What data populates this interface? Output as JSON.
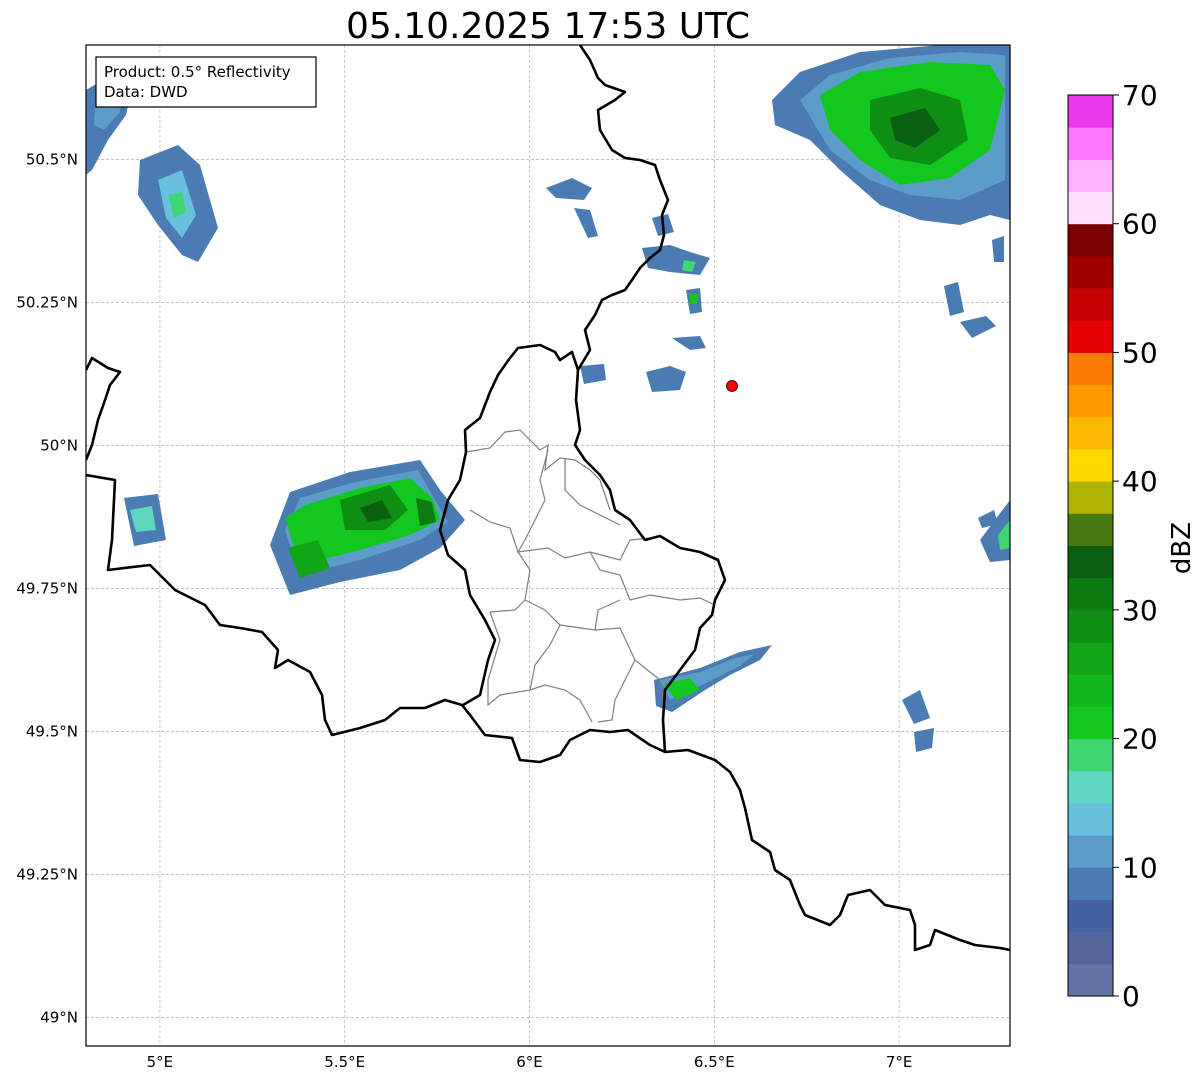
{
  "title": "05.10.2025 17:53 UTC",
  "info_box": {
    "product": "Product: 0.5° Reflectivity",
    "data": "Data: DWD"
  },
  "map": {
    "lon_ticks": [
      "5°E",
      "5.5°E",
      "6°E",
      "6.5°E",
      "7°E"
    ],
    "lat_ticks": [
      "50.5°N",
      "50.25°N",
      "50°N",
      "49.75°N",
      "49.5°N",
      "49.25°N",
      "49°N"
    ],
    "extent": {
      "lon_min": 4.8,
      "lon_max": 7.3,
      "lat_min": 48.95,
      "lat_max": 50.7
    },
    "radar_site": {
      "lon": 6.55,
      "lat": 50.11,
      "color": "#ff0000"
    },
    "border_color": "#000000",
    "admin_border_color": "#808080",
    "grid": true
  },
  "colorbar": {
    "label": "dBZ",
    "tick_labels": [
      "0",
      "10",
      "20",
      "30",
      "40",
      "50",
      "60",
      "70"
    ],
    "min": 0,
    "max": 70,
    "step": 2.5,
    "colors": [
      "#6474a4",
      "#53669c",
      "#4762a2",
      "#4a7bb2",
      "#5b9dc8",
      "#67c0dc",
      "#5fd6c0",
      "#3fd672",
      "#12c81e",
      "#12b81c",
      "#10a616",
      "#0f8e14",
      "#0d7a12",
      "#0a6010",
      "#477a10",
      "#afb303",
      "#ffd800",
      "#ffb800",
      "#ff9a00",
      "#ff7a00",
      "#e20000",
      "#c40000",
      "#a20000",
      "#7a0000",
      "#ffe0ff",
      "#ffb2ff",
      "#ff78ff",
      "#ea3aea"
    ]
  }
}
